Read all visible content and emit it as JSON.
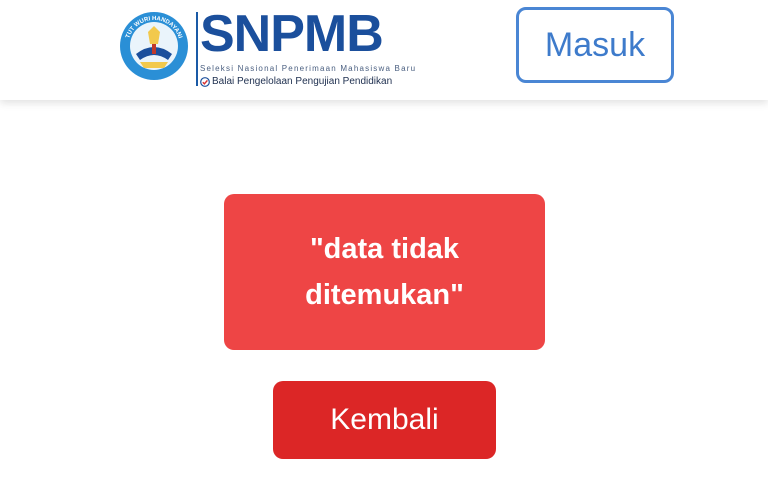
{
  "header": {
    "logo": {
      "emblem_text": "TUT WURI HANDAYANI",
      "title": "SNPMB",
      "subtitle": "Seleksi Nasional Penerimaan Mahasiswa Baru",
      "org": "Balai Pengelolaan Pengujian Pendidikan"
    },
    "login_label": "Masuk"
  },
  "main": {
    "error_message": "\"data tidak ditemukan\"",
    "back_label": "Kembali"
  },
  "colors": {
    "brand_blue": "#1b4f9c",
    "login_border": "#4a86d4",
    "error_bg": "#ee4545",
    "back_bg": "#dc2626"
  },
  "icons": [
    "tut-wuri-handayani-emblem",
    "check-badge-icon"
  ]
}
